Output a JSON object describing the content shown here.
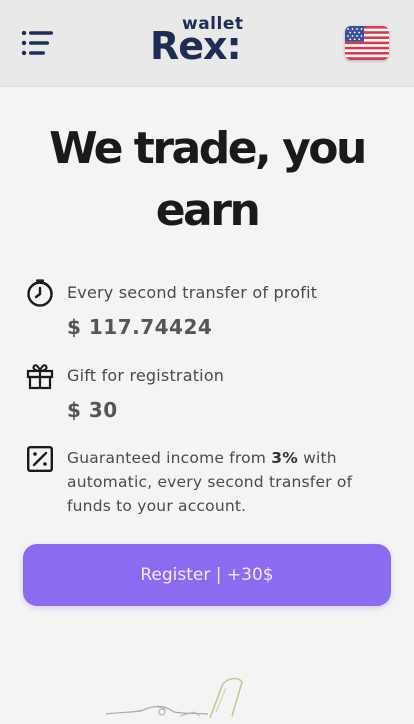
{
  "header": {
    "menu_icon": "menu-icon",
    "logo_small": "wallet",
    "logo_main": "Rex:",
    "language_icon": "us-flag-icon"
  },
  "hero": {
    "title": "We trade, you earn"
  },
  "features": {
    "profit": {
      "icon": "timer-icon",
      "label": "Every second transfer of profit",
      "value": "$ 117.74424"
    },
    "gift": {
      "icon": "gift-icon",
      "label": "Gift for registration",
      "value": "$ 30"
    },
    "income": {
      "icon": "percent-icon",
      "text_before": "Guaranteed income from ",
      "text_bold": "3%",
      "text_after": " with automatic, every second transfer of funds to your account."
    }
  },
  "cta": {
    "register_label": "Register | +30$"
  },
  "colors": {
    "accent": "#8a6cf0",
    "brand": "#1f2d55",
    "background": "#f4f4f4"
  }
}
